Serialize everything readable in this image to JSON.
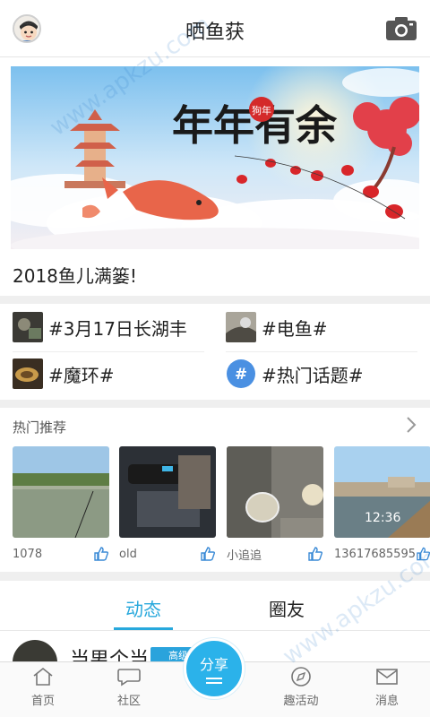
{
  "header": {
    "title": "晒鱼获",
    "avatar_icon": "user-avatar",
    "camera_icon": "camera-icon"
  },
  "banner": {
    "headline": "年年有余",
    "seal_text": "狗年",
    "caption": "2018鱼儿满篓!"
  },
  "topics": [
    {
      "label": "#3月17日长湖丰",
      "icon": "topic-thumbnail"
    },
    {
      "label": "#电鱼#",
      "icon": "topic-thumbnail"
    },
    {
      "label": "#魔环#",
      "icon": "topic-thumbnail"
    },
    {
      "label": "#热门话题#",
      "icon": "hashtag-icon"
    }
  ],
  "hot": {
    "title": "热门推荐",
    "items": [
      {
        "user": "1078",
        "photo_timestamp": ""
      },
      {
        "user": "old",
        "photo_timestamp": ""
      },
      {
        "user": "小追追",
        "photo_timestamp": ""
      },
      {
        "user": "13617685595",
        "photo_timestamp": "12:36"
      }
    ]
  },
  "tabs": [
    {
      "label": "动态",
      "active": true
    },
    {
      "label": "圈友",
      "active": false
    }
  ],
  "feed": {
    "name": "当男个当",
    "badge": "高级钓"
  },
  "nav": [
    {
      "label": "首页",
      "icon": "home-icon"
    },
    {
      "label": "社区",
      "icon": "chat-icon"
    },
    {
      "label": "分享",
      "icon": "share-icon"
    },
    {
      "label": "趣活动",
      "icon": "compass-icon"
    },
    {
      "label": "消息",
      "icon": "mail-icon"
    }
  ],
  "watermark": "www.apkzu.com",
  "colors": {
    "accent": "#27a8dc",
    "share": "#2bb2ea"
  }
}
